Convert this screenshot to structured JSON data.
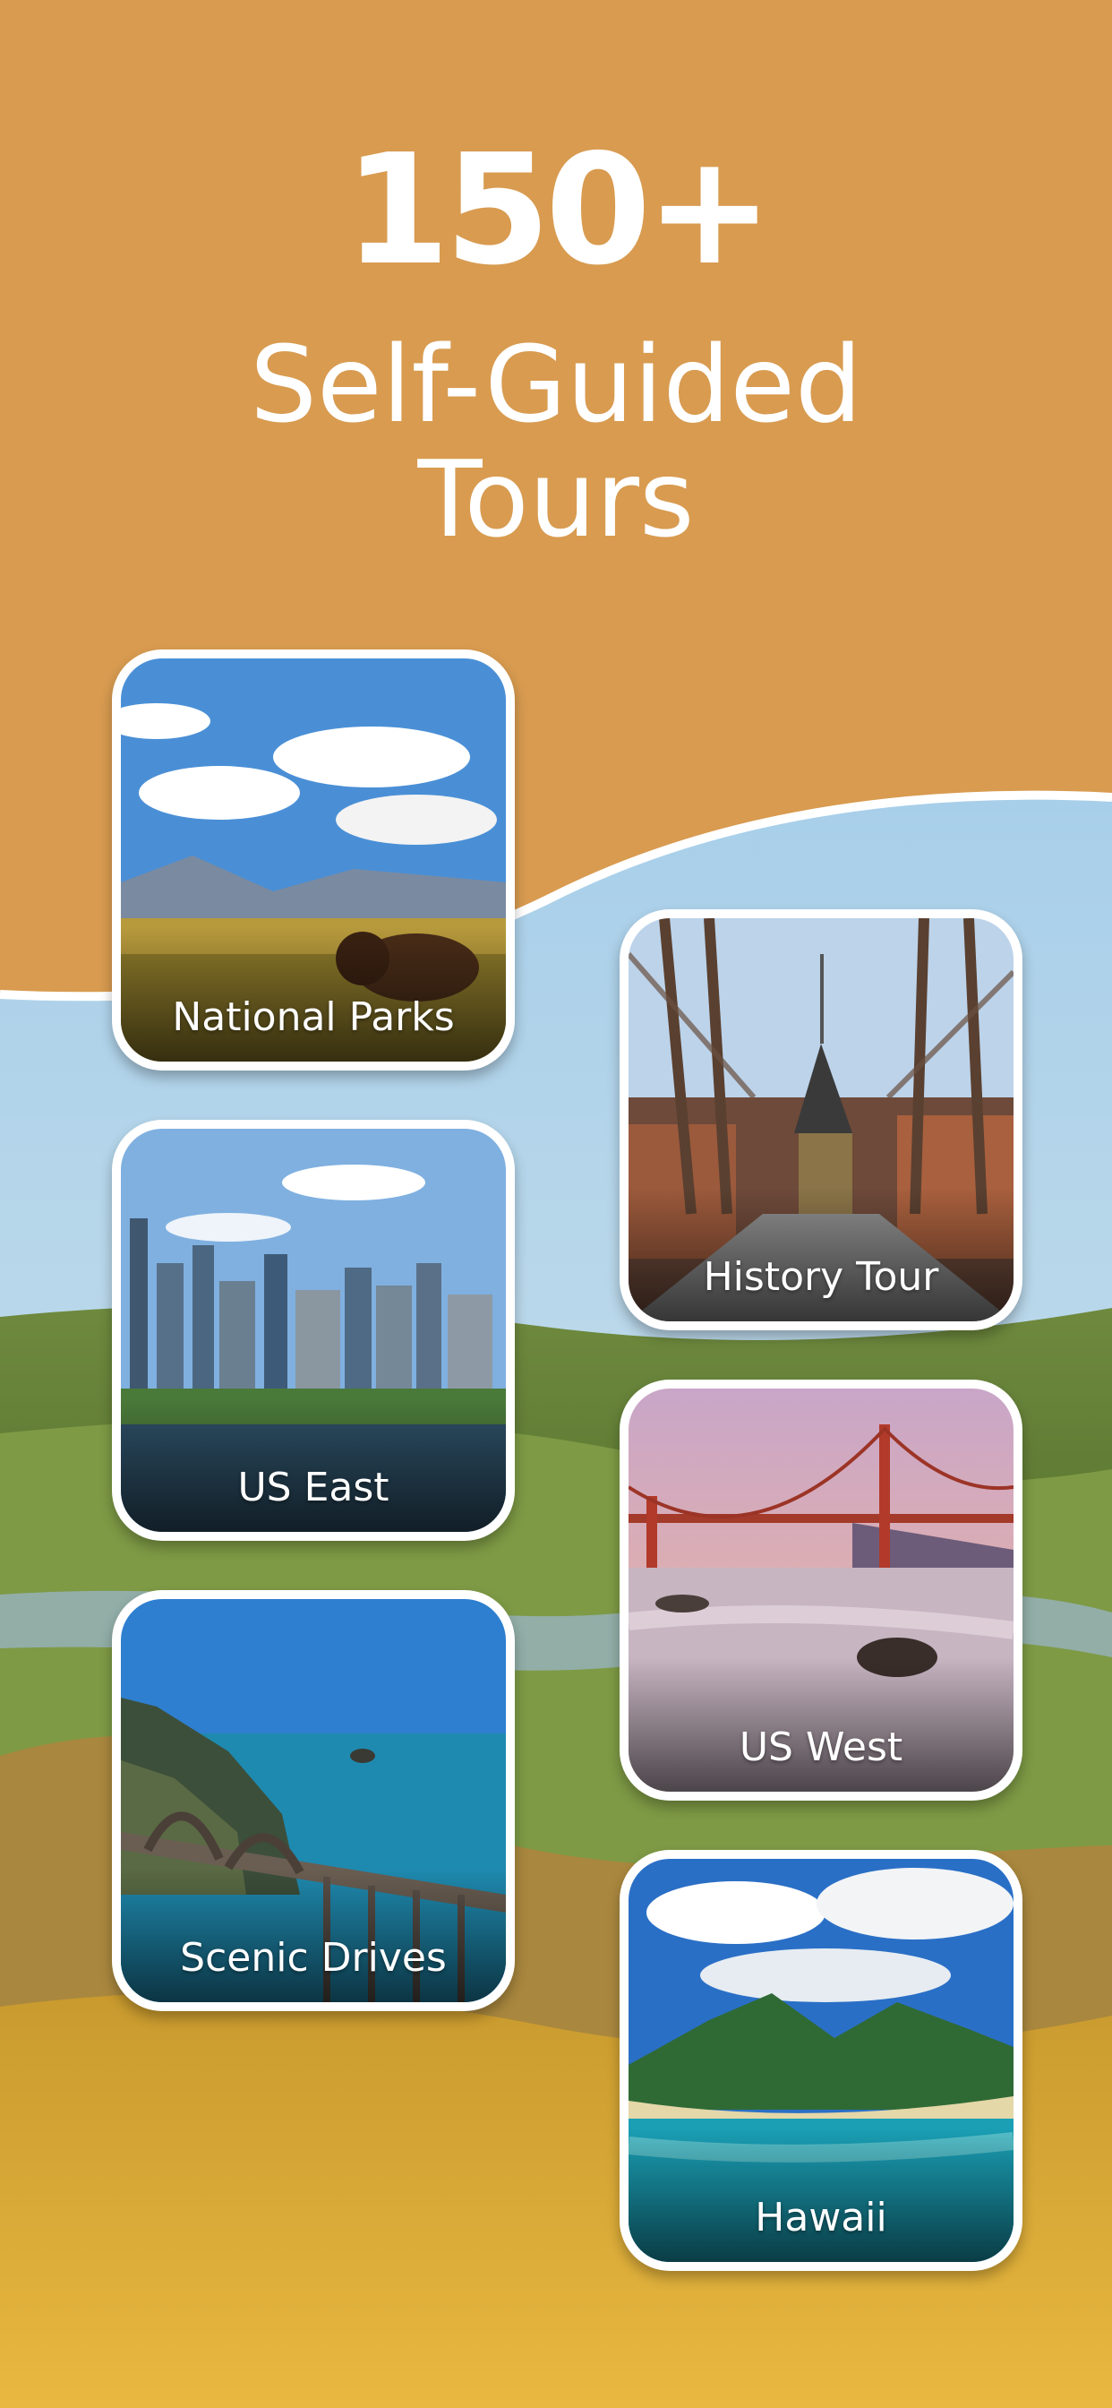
{
  "headline": {
    "count": "150+",
    "line1": "Self-Guided",
    "line2": "Tours"
  },
  "tours": [
    {
      "label": "National Parks"
    },
    {
      "label": "History Tour"
    },
    {
      "label": "US East"
    },
    {
      "label": "US West"
    },
    {
      "label": "Scenic Drives"
    },
    {
      "label": "Hawaii"
    }
  ],
  "colors": {
    "banner": "#d89b50",
    "text": "#ffffff",
    "card_border": "#ffffff"
  }
}
